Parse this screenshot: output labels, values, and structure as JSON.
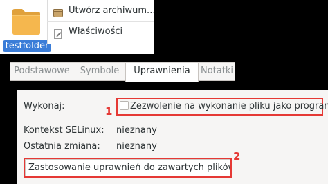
{
  "desktop": {
    "folder_label": "testfolder",
    "folder_icon": "folder-icon",
    "selection_color": "#3b7dd8"
  },
  "context_menu": {
    "items": [
      {
        "label": "Utwórz archiwum...",
        "icon": "archive-icon"
      },
      {
        "label": "Właściwości",
        "icon": "properties-icon"
      }
    ]
  },
  "tabs": [
    {
      "label": "Podstawowe",
      "active": false
    },
    {
      "label": "Symbole",
      "active": false
    },
    {
      "label": "Uprawnienia",
      "active": true
    },
    {
      "label": "Notatki",
      "active": false
    }
  ],
  "permissions": {
    "execute_label": "Wykonaj:",
    "execute_checkbox_label": "Zezwolenie na wykonanie pliku jako programu",
    "execute_checked": false,
    "selinux_label": "Kontekst SELinux:",
    "selinux_value": "nieznany",
    "last_changed_label": "Ostatnia zmiana:",
    "last_changed_value": "nieznany",
    "apply_button_label": "Zastosowanie uprawnień do zawartych plików"
  },
  "annotations": {
    "marker_1": "1",
    "marker_2": "2",
    "highlight_color": "#e53935"
  }
}
